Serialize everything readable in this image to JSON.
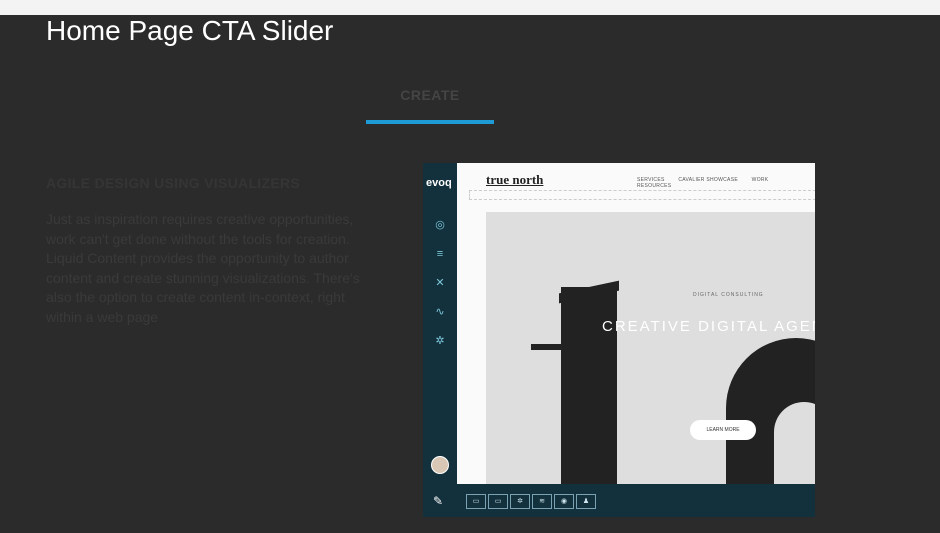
{
  "page": {
    "title": "Home Page CTA Slider",
    "tab_label": "CREATE",
    "section_heading": "AGILE DESIGN USING VISUALIZERS",
    "section_body": "Just as inspiration requires creative opportunities, work can't get done without the tools for creation. Liquid Content provides the opportunity to author content and create stunning visualizations. There's also the option to create content in-context, right within a web page"
  },
  "colors": {
    "accent": "#1e9ad6",
    "dark_background": "#2b2b2b",
    "sidebar": "#13303d"
  },
  "screenshot": {
    "app_logo": "evoq",
    "sidebar_icons": [
      "dashboard-icon",
      "pages-icon",
      "tools-icon",
      "analytics-icon",
      "settings-icon"
    ],
    "site_brand": "true north",
    "nav_items": [
      "SERVICES",
      "CAVALIER SHOWCASE",
      "WORK",
      "RESOURCES"
    ],
    "kicker": "DIGITAL CONSULTING",
    "headline": "CREATIVE DIGITAL AGEN",
    "cta": "LEARN MORE",
    "toolbar_icons": [
      "module-icon",
      "modules-icon",
      "gear-icon",
      "layers-icon",
      "eye-icon",
      "user-icon"
    ]
  }
}
